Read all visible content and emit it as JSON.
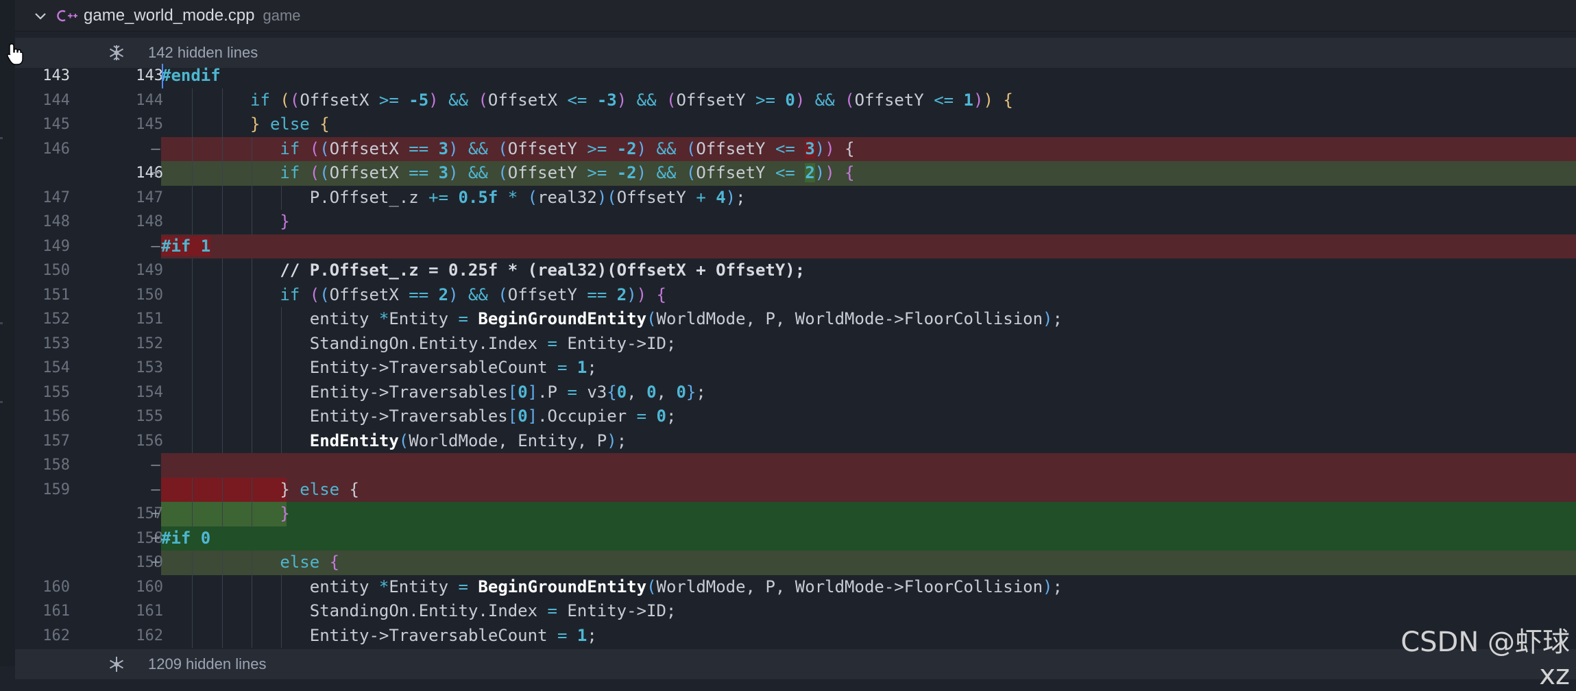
{
  "file": {
    "name": "game_world_mode.cpp",
    "dir": "game"
  },
  "hidden_top": "142 hidden lines",
  "hidden_bottom": "1209 hidden lines",
  "watermark": "CSDN @虾球xz",
  "lines": [
    {
      "o": "143",
      "n": "143",
      "type": "ctx",
      "indent": 0,
      "cur": true,
      "tokens": [
        [
          "pp",
          "#endif"
        ]
      ]
    },
    {
      "o": "144",
      "n": "144",
      "type": "ctx",
      "indent": 3,
      "tokens": [
        [
          "k",
          "if "
        ],
        [
          "p1",
          "("
        ],
        [
          "p2",
          "("
        ],
        [
          "t",
          "OffsetX "
        ],
        [
          "op",
          ">="
        ],
        [
          "t",
          " "
        ],
        [
          "n",
          "-5"
        ],
        [
          "p2",
          ")"
        ],
        [
          "t",
          " "
        ],
        [
          "op",
          "&&"
        ],
        [
          "t",
          " "
        ],
        [
          "p2",
          "("
        ],
        [
          "t",
          "OffsetX "
        ],
        [
          "op",
          "<="
        ],
        [
          "t",
          " "
        ],
        [
          "n",
          "-3"
        ],
        [
          "p2",
          ")"
        ],
        [
          "t",
          " "
        ],
        [
          "op",
          "&&"
        ],
        [
          "t",
          " "
        ],
        [
          "p2",
          "("
        ],
        [
          "t",
          "OffsetY "
        ],
        [
          "op",
          ">="
        ],
        [
          "t",
          " "
        ],
        [
          "n",
          "0"
        ],
        [
          "p2",
          ")"
        ],
        [
          "t",
          " "
        ],
        [
          "op",
          "&&"
        ],
        [
          "t",
          " "
        ],
        [
          "p2",
          "("
        ],
        [
          "t",
          "OffsetY "
        ],
        [
          "op",
          "<="
        ],
        [
          "t",
          " "
        ],
        [
          "n",
          "1"
        ],
        [
          "p2",
          ")"
        ],
        [
          "p1",
          ")"
        ],
        [
          "t",
          " "
        ],
        [
          "p1",
          "{"
        ]
      ]
    },
    {
      "o": "145",
      "n": "145",
      "type": "ctx",
      "indent": 3,
      "tokens": [
        [
          "p1",
          "}"
        ],
        [
          "t",
          " "
        ],
        [
          "k",
          "else"
        ],
        [
          "t",
          " "
        ],
        [
          "p1",
          "{"
        ]
      ]
    },
    {
      "o": "146",
      "n": "",
      "type": "del",
      "mark": "—",
      "indent": 4,
      "tokens": [
        [
          "k",
          "if "
        ],
        [
          "p2",
          "("
        ],
        [
          "p3",
          "("
        ],
        [
          "t",
          "OffsetX "
        ],
        [
          "op",
          "=="
        ],
        [
          "t",
          " "
        ],
        [
          "n",
          "3"
        ],
        [
          "p3",
          ")"
        ],
        [
          "t",
          " "
        ],
        [
          "op",
          "&&"
        ],
        [
          "t",
          " "
        ],
        [
          "p3",
          "("
        ],
        [
          "t",
          "OffsetY "
        ],
        [
          "op",
          ">="
        ],
        [
          "t",
          " "
        ],
        [
          "n",
          "-2"
        ],
        [
          "p3",
          ")"
        ],
        [
          "t",
          " "
        ],
        [
          "op",
          "&&"
        ],
        [
          "t",
          " "
        ],
        [
          "p3",
          "("
        ],
        [
          "t",
          "OffsetY "
        ],
        [
          "op",
          "<="
        ],
        [
          "t",
          " "
        ],
        [
          "hl",
          "3"
        ],
        [
          "p3",
          ")"
        ],
        [
          "p2",
          ")"
        ],
        [
          "t",
          " "
        ],
        [
          "t",
          "{"
        ]
      ]
    },
    {
      "o": "",
      "n": "146",
      "type": "add",
      "mark": "+",
      "indent": 4,
      "curn": true,
      "tokens": [
        [
          "k",
          "if "
        ],
        [
          "p2",
          "("
        ],
        [
          "p3",
          "("
        ],
        [
          "t",
          "OffsetX "
        ],
        [
          "op",
          "=="
        ],
        [
          "t",
          " "
        ],
        [
          "n",
          "3"
        ],
        [
          "p3",
          ")"
        ],
        [
          "t",
          " "
        ],
        [
          "op",
          "&&"
        ],
        [
          "t",
          " "
        ],
        [
          "p3",
          "("
        ],
        [
          "t",
          "OffsetY "
        ],
        [
          "op",
          ">="
        ],
        [
          "t",
          " "
        ],
        [
          "n",
          "-2"
        ],
        [
          "p3",
          ")"
        ],
        [
          "t",
          " "
        ],
        [
          "op",
          "&&"
        ],
        [
          "t",
          " "
        ],
        [
          "p3",
          "("
        ],
        [
          "t",
          "OffsetY "
        ],
        [
          "op",
          "<="
        ],
        [
          "t",
          " "
        ],
        [
          "hla",
          "2"
        ],
        [
          "p3",
          ")"
        ],
        [
          "p2",
          ")"
        ],
        [
          "t",
          " "
        ],
        [
          "p2",
          "{"
        ]
      ]
    },
    {
      "o": "147",
      "n": "147",
      "type": "ctx",
      "indent": 5,
      "tokens": [
        [
          "t",
          "P.Offset_.z "
        ],
        [
          "op",
          "+="
        ],
        [
          "t",
          " "
        ],
        [
          "n",
          "0.5f"
        ],
        [
          "t",
          " "
        ],
        [
          "op",
          "*"
        ],
        [
          "t",
          " "
        ],
        [
          "p3",
          "("
        ],
        [
          "t",
          "real32"
        ],
        [
          "p3",
          ")"
        ],
        [
          "p3",
          "("
        ],
        [
          "t",
          "OffsetY "
        ],
        [
          "op",
          "+"
        ],
        [
          "t",
          " "
        ],
        [
          "n",
          "4"
        ],
        [
          "p3",
          ")"
        ],
        [
          "t",
          ";"
        ]
      ]
    },
    {
      "o": "148",
      "n": "148",
      "type": "ctx",
      "indent": 4,
      "tokens": [
        [
          "p2",
          "}"
        ]
      ]
    },
    {
      "o": "149",
      "n": "",
      "type": "del",
      "mark": "—",
      "indent": 0,
      "tokens": [
        [
          "hlpp",
          "#if 1"
        ]
      ]
    },
    {
      "o": "150",
      "n": "149",
      "type": "ctx",
      "indent": 4,
      "tokens": [
        [
          "cm",
          "// P.Offset_.z = 0.25f * (real32)(OffsetX + OffsetY);"
        ]
      ]
    },
    {
      "o": "151",
      "n": "150",
      "type": "ctx",
      "indent": 4,
      "tokens": [
        [
          "k",
          "if "
        ],
        [
          "p2",
          "("
        ],
        [
          "p3",
          "("
        ],
        [
          "t",
          "OffsetX "
        ],
        [
          "op",
          "=="
        ],
        [
          "t",
          " "
        ],
        [
          "n",
          "2"
        ],
        [
          "p3",
          ")"
        ],
        [
          "t",
          " "
        ],
        [
          "op",
          "&&"
        ],
        [
          "t",
          " "
        ],
        [
          "p3",
          "("
        ],
        [
          "t",
          "OffsetY "
        ],
        [
          "op",
          "=="
        ],
        [
          "t",
          " "
        ],
        [
          "n",
          "2"
        ],
        [
          "p3",
          ")"
        ],
        [
          "p2",
          ")"
        ],
        [
          "t",
          " "
        ],
        [
          "p2",
          "{"
        ]
      ]
    },
    {
      "o": "152",
      "n": "151",
      "type": "ctx",
      "indent": 5,
      "tokens": [
        [
          "t",
          "entity "
        ],
        [
          "op",
          "*"
        ],
        [
          "t",
          "Entity "
        ],
        [
          "op",
          "="
        ],
        [
          "t",
          " "
        ],
        [
          "f",
          "BeginGroundEntity"
        ],
        [
          "p3",
          "("
        ],
        [
          "t",
          "WorldMode, P, WorldMode->FloorCollision"
        ],
        [
          "p3",
          ")"
        ],
        [
          "t",
          ";"
        ]
      ]
    },
    {
      "o": "153",
      "n": "152",
      "type": "ctx",
      "indent": 5,
      "tokens": [
        [
          "t",
          "StandingOn.Entity.Index "
        ],
        [
          "op",
          "="
        ],
        [
          "t",
          " Entity->ID;"
        ]
      ]
    },
    {
      "o": "154",
      "n": "153",
      "type": "ctx",
      "indent": 5,
      "tokens": [
        [
          "t",
          "Entity->TraversableCount "
        ],
        [
          "op",
          "="
        ],
        [
          "t",
          " "
        ],
        [
          "n",
          "1"
        ],
        [
          "t",
          ";"
        ]
      ]
    },
    {
      "o": "155",
      "n": "154",
      "type": "ctx",
      "indent": 5,
      "tokens": [
        [
          "t",
          "Entity->Traversables"
        ],
        [
          "p3",
          "["
        ],
        [
          "n",
          "0"
        ],
        [
          "p3",
          "]"
        ],
        [
          "t",
          ".P "
        ],
        [
          "op",
          "="
        ],
        [
          "t",
          " v3"
        ],
        [
          "p3",
          "{"
        ],
        [
          "n",
          "0"
        ],
        [
          "t",
          ", "
        ],
        [
          "n",
          "0"
        ],
        [
          "t",
          ", "
        ],
        [
          "n",
          "0"
        ],
        [
          "p3",
          "}"
        ],
        [
          "t",
          ";"
        ]
      ]
    },
    {
      "o": "156",
      "n": "155",
      "type": "ctx",
      "indent": 5,
      "tokens": [
        [
          "t",
          "Entity->Traversables"
        ],
        [
          "p3",
          "["
        ],
        [
          "n",
          "0"
        ],
        [
          "p3",
          "]"
        ],
        [
          "t",
          ".Occupier "
        ],
        [
          "op",
          "="
        ],
        [
          "t",
          " "
        ],
        [
          "n",
          "0"
        ],
        [
          "t",
          ";"
        ]
      ]
    },
    {
      "o": "157",
      "n": "156",
      "type": "ctx",
      "indent": 5,
      "tokens": [
        [
          "f",
          "EndEntity"
        ],
        [
          "p3",
          "("
        ],
        [
          "t",
          "WorldMode, Entity, P"
        ],
        [
          "p3",
          ")"
        ],
        [
          "t",
          ";"
        ]
      ]
    },
    {
      "o": "158",
      "n": "",
      "type": "del",
      "mark": "—",
      "indent": 0,
      "tokens": []
    },
    {
      "o": "159",
      "n": "",
      "type": "del",
      "mark": "—",
      "indent": 4,
      "blockhl": true,
      "tokens": [
        [
          "t",
          "} "
        ],
        [
          "k",
          "else"
        ],
        [
          "t",
          " {"
        ]
      ]
    },
    {
      "o": "",
      "n": "157",
      "type": "add2",
      "mark": "+",
      "indent": 4,
      "blockhla": true,
      "tokens": [
        [
          "p2",
          "}"
        ]
      ]
    },
    {
      "o": "",
      "n": "158",
      "type": "add2",
      "mark": "+",
      "indent": 0,
      "tokens": [
        [
          "pp",
          "#if "
        ],
        [
          "n",
          "0"
        ]
      ]
    },
    {
      "o": "",
      "n": "159",
      "type": "add",
      "mark": "+",
      "indent": 4,
      "tokens": [
        [
          "k",
          "else"
        ],
        [
          "t",
          " "
        ],
        [
          "p2",
          "{"
        ]
      ]
    },
    {
      "o": "160",
      "n": "160",
      "type": "ctx",
      "indent": 5,
      "tokens": [
        [
          "t",
          "entity "
        ],
        [
          "op",
          "*"
        ],
        [
          "t",
          "Entity "
        ],
        [
          "op",
          "="
        ],
        [
          "t",
          " "
        ],
        [
          "f",
          "BeginGroundEntity"
        ],
        [
          "p3",
          "("
        ],
        [
          "t",
          "WorldMode, P, WorldMode->FloorCollision"
        ],
        [
          "p3",
          ")"
        ],
        [
          "t",
          ";"
        ]
      ]
    },
    {
      "o": "161",
      "n": "161",
      "type": "ctx",
      "indent": 5,
      "tokens": [
        [
          "t",
          "StandingOn.Entity.Index "
        ],
        [
          "op",
          "="
        ],
        [
          "t",
          " Entity->ID;"
        ]
      ]
    },
    {
      "o": "162",
      "n": "162",
      "type": "ctx",
      "indent": 5,
      "tokens": [
        [
          "t",
          "Entity->TraversableCount "
        ],
        [
          "op",
          "="
        ],
        [
          "t",
          " "
        ],
        [
          "n",
          "1"
        ],
        [
          "t",
          ";"
        ]
      ]
    }
  ]
}
